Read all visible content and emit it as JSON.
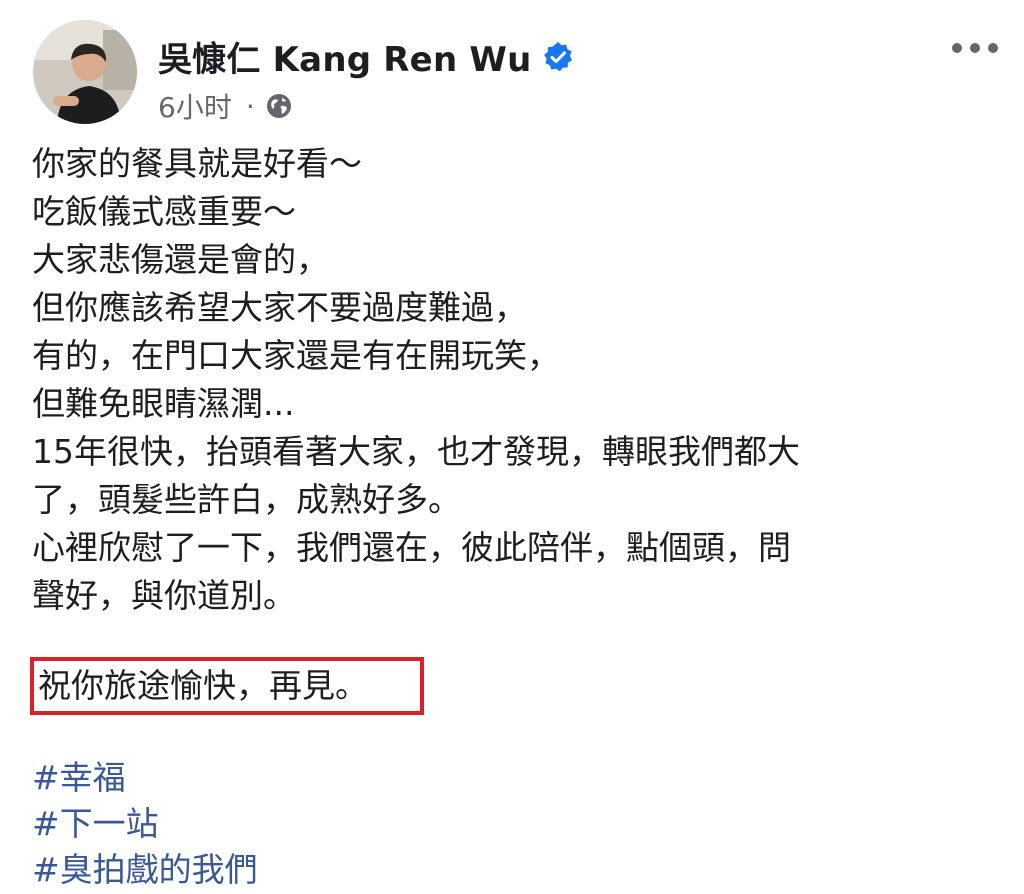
{
  "post": {
    "author_name": "吳慷仁 Kang Ren Wu",
    "verified": true,
    "time_ago": "6小时",
    "separator": "·",
    "privacy_icon": "globe-icon",
    "more_icon": "more-options-icon",
    "body_lines": [
      "你家的餐具就是好看～",
      "吃飯儀式感重要～",
      "大家悲傷還是會的，",
      "但你應該希望大家不要過度難過，",
      "有的，在門口大家還是有在開玩笑，",
      "但難免眼睛濕潤...",
      "15年很快，抬頭看著大家，也才發現，轉眼我們都大",
      "了，頭髮些許白，成熟好多。",
      "心裡欣慰了一下，我們還在，彼此陪伴，點個頭，問",
      "聲好，與你道別。"
    ],
    "highlighted_line": "祝你旅途愉快，再見。",
    "hashtags": [
      "#幸福",
      "#下一站",
      "#臭拍戲的我們"
    ]
  },
  "colors": {
    "text": "#1c1e21",
    "meta": "#65676b",
    "verified_blue": "#1877f2",
    "hashtag": "#385898",
    "highlight_border": "#d9202b"
  }
}
